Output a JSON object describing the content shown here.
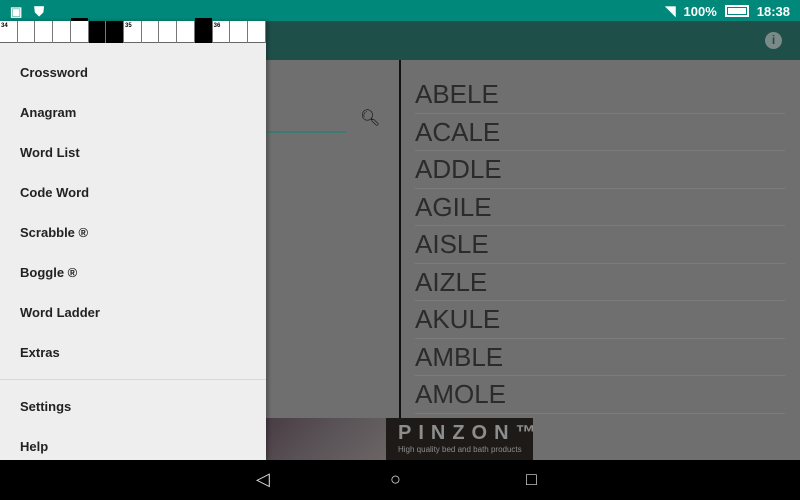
{
  "status": {
    "battery": "100%",
    "time": "18:38",
    "icons": [
      "image-icon",
      "shield-icon",
      "wifi-icon",
      "battery-icon"
    ]
  },
  "grid": {
    "cells": [
      {
        "n": "34"
      },
      {},
      {},
      {},
      {
        "top": true
      },
      {
        "black": true
      },
      {
        "black": true
      },
      {
        "n": "35"
      },
      {},
      {},
      {},
      {
        "black": true,
        "top": true
      },
      {
        "n": "36"
      },
      {},
      {}
    ]
  },
  "drawer": {
    "items": [
      "Crossword",
      "Anagram",
      "Word List",
      "Code Word",
      "Scrabble ®",
      "Boggle ®",
      "Word Ladder",
      "Extras"
    ],
    "footer_items": [
      "Settings",
      "Help"
    ]
  },
  "words": [
    "ABELE",
    "ACALE",
    "ADDLE",
    "AGILE",
    "AISLE",
    "AIZLE",
    "AKULE",
    "AMBLE",
    "AMOLE"
  ],
  "ad": {
    "brand": "PINZON™",
    "tagline": "High quality bed and bath products"
  },
  "colors": {
    "status": "#00897b",
    "appbar": "#1f4f49"
  }
}
